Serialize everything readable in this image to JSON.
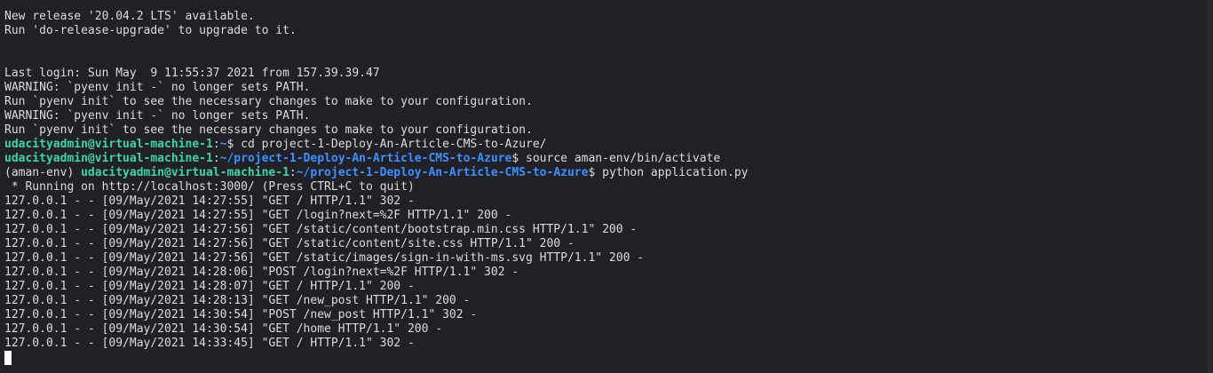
{
  "terminal": {
    "motd": [
      "New release '20.04.2 LTS' available.",
      "Run 'do-release-upgrade' to upgrade to it."
    ],
    "login": [
      "Last login: Sun May  9 11:55:37 2021 from 157.39.39.47",
      "WARNING: `pyenv init -` no longer sets PATH.",
      "Run `pyenv init` to see the necessary changes to make to your configuration.",
      "WARNING: `pyenv init -` no longer sets PATH.",
      "Run `pyenv init` to see the necessary changes to make to your configuration."
    ],
    "prompts": [
      {
        "env": "",
        "user_host": "udacityadmin@virtual-machine-1",
        "colon": ":",
        "path": "~",
        "dollar": "$ ",
        "command": "cd project-1-Deploy-An-Article-CMS-to-Azure/"
      },
      {
        "env": "",
        "user_host": "udacityadmin@virtual-machine-1",
        "colon": ":",
        "path": "~/project-1-Deploy-An-Article-CMS-to-Azure",
        "dollar": "$ ",
        "command": "source aman-env/bin/activate"
      },
      {
        "env": "(aman-env) ",
        "user_host": "udacityadmin@virtual-machine-1",
        "colon": ":",
        "path": "~/project-1-Deploy-An-Article-CMS-to-Azure",
        "dollar": "$ ",
        "command": "python application.py"
      }
    ],
    "server_output": [
      " * Running on http://localhost:3000/ (Press CTRL+C to quit)",
      "127.0.0.1 - - [09/May/2021 14:27:55] \"GET / HTTP/1.1\" 302 -",
      "127.0.0.1 - - [09/May/2021 14:27:55] \"GET /login?next=%2F HTTP/1.1\" 200 -",
      "127.0.0.1 - - [09/May/2021 14:27:56] \"GET /static/content/bootstrap.min.css HTTP/1.1\" 200 -",
      "127.0.0.1 - - [09/May/2021 14:27:56] \"GET /static/content/site.css HTTP/1.1\" 200 -",
      "127.0.0.1 - - [09/May/2021 14:27:56] \"GET /static/images/sign-in-with-ms.svg HTTP/1.1\" 200 -",
      "127.0.0.1 - - [09/May/2021 14:28:06] \"POST /login?next=%2F HTTP/1.1\" 302 -",
      "127.0.0.1 - - [09/May/2021 14:28:07] \"GET / HTTP/1.1\" 200 -",
      "127.0.0.1 - - [09/May/2021 14:28:13] \"GET /new_post HTTP/1.1\" 200 -",
      "127.0.0.1 - - [09/May/2021 14:30:54] \"POST /new_post HTTP/1.1\" 302 -",
      "127.0.0.1 - - [09/May/2021 14:30:54] \"GET /home HTTP/1.1\" 200 -",
      "127.0.0.1 - - [09/May/2021 14:33:45] \"GET / HTTP/1.1\" 302 -"
    ]
  },
  "colors": {
    "background": "#202026",
    "text": "#dcdcdc",
    "user_host": "#3fd6a1",
    "path": "#3f8fff",
    "cursor": "#ffffff"
  }
}
